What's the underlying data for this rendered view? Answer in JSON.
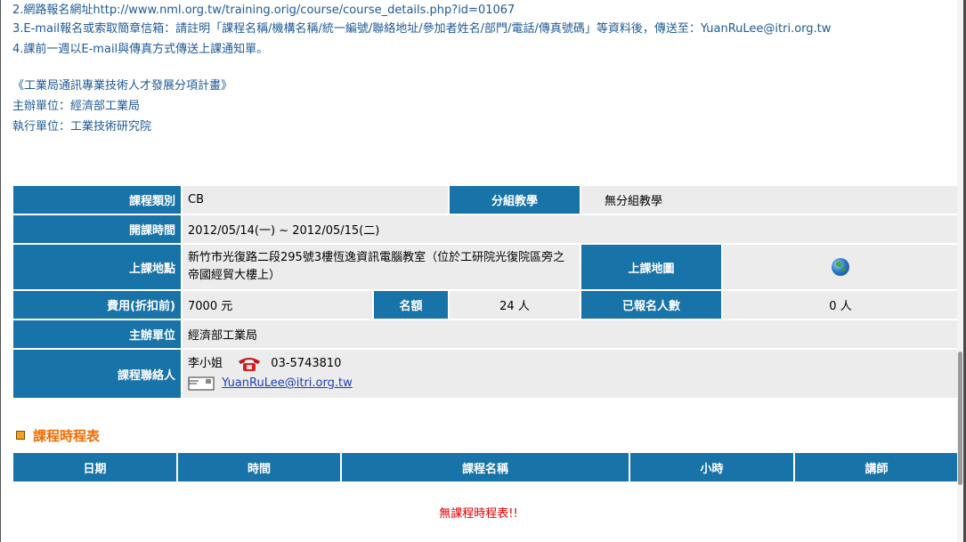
{
  "info": {
    "line1": "2.網路報名網址http://www.nml.org.tw/training.orig/course/course_details.php?id=01067",
    "line2": "3.E-mail報名或索取簡章信箱：請註明「課程名稱/機構名稱/統一編號/聯絡地址/參加者姓名/部門/電話/傳真號碼」等資料後，傳送至：YuanRuLee@itri.org.tw",
    "line3": "4.課前一週以E-mail與傳真方式傳送上課通知單。",
    "program": "《工業局通訊專業技術人才發展分項計畫》",
    "organizer": "主辦單位：經濟部工業局",
    "executor": "執行單位：工業技術研究院"
  },
  "detail": {
    "category_label": "課程類別",
    "category_value": "CB",
    "group_label": "分組教學",
    "group_value": "無分組教學",
    "time_label": "開課時間",
    "time_value": "2012/05/14(一) ~ 2012/05/15(二)",
    "location_label": "上課地點",
    "location_value": "新竹市光復路二段295號3樓恆逸資訊電腦教室（位於工研院光復院區旁之帝國經貿大樓上）",
    "map_label": "上課地圖",
    "fee_label": "費用(折扣前)",
    "fee_value": "7000 元",
    "quota_label": "名額",
    "quota_value": "24 人",
    "registered_label": "已報名人數",
    "registered_value": "0 人",
    "host_label": "主辦單位",
    "host_value": "經濟部工業局",
    "contact_label": "課程聯絡人",
    "contact_name": "李小姐",
    "contact_phone": "03-5743810",
    "contact_email": "YuanRuLee@itri.org.tw"
  },
  "schedule": {
    "title": "課程時程表",
    "headers": [
      "日期",
      "時間",
      "課程名稱",
      "小時",
      "講師"
    ],
    "empty_message": "無課程時程表!!"
  },
  "icons": {
    "map": "globe-icon",
    "phone": "telephone-icon",
    "email": "envelope-icon",
    "bullet": "square-bullet-icon"
  },
  "colors": {
    "header_blue": "#1873a8",
    "text_blue": "#1f5a96",
    "section_orange": "#ef6b00",
    "empty_red": "#e00000",
    "cell_gray": "#ececec"
  }
}
